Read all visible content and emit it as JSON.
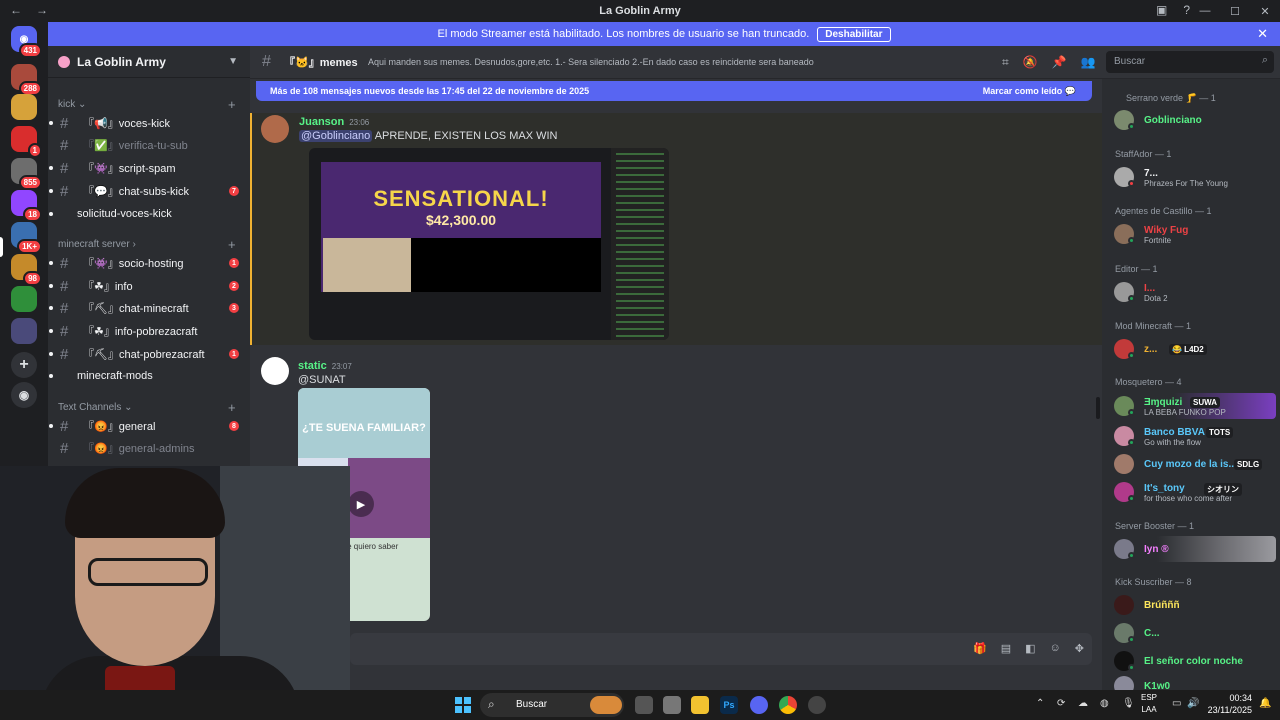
{
  "window": {
    "title": "La Goblin Army",
    "back": "←",
    "forward": "→",
    "minimize": "—",
    "maximize": "☐",
    "close": "✕"
  },
  "banner": {
    "text": "El modo Streamer está habilitado. Los nombres de usuario se han truncado.",
    "button": "Deshabilitar",
    "close": "✕"
  },
  "guilds": [
    {
      "badge": "431",
      "color": "#5865f2",
      "label": "◉"
    },
    {
      "badge": "288",
      "color": "#a94a3c",
      "label": ""
    },
    {
      "badge": "",
      "color": "#d6a23a",
      "label": ""
    },
    {
      "badge": "1",
      "color": "#d92d2d",
      "label": ""
    },
    {
      "badge": "855",
      "color": "#6d6d6d",
      "label": ""
    },
    {
      "badge": "18",
      "color": "#9146ff",
      "label": ""
    },
    {
      "badge": "1K+",
      "color": "#3a6fb0",
      "label": ""
    },
    {
      "badge": "98",
      "color": "#c58a2a",
      "label": ""
    },
    {
      "badge": "",
      "color": "#2f8f3a",
      "label": ""
    },
    {
      "badge": "",
      "color": "#4a4a7a",
      "label": ""
    }
  ],
  "sidebar": {
    "server_name": "La Goblin Army",
    "categories": {
      "kick": "kick",
      "minecraft": "minecraft server",
      "text": "Text Channels",
      "plus": "+"
    },
    "channels": [
      {
        "name": "『📢』voces-kick",
        "muted": false,
        "count": ""
      },
      {
        "name": "『✅』verifica-tu-sub",
        "muted": true,
        "count": ""
      },
      {
        "name": "『👾』script-spam",
        "muted": false,
        "count": ""
      },
      {
        "name": "『💬』chat-subs-kick",
        "muted": false,
        "count": "7"
      },
      {
        "name": "solicitud-voces-kick",
        "muted": false,
        "count": ""
      },
      {
        "name": "『👾』socio-hosting",
        "muted": false,
        "count": "1"
      },
      {
        "name": "『☘』info",
        "muted": false,
        "count": "2"
      },
      {
        "name": "『⛏』chat-minecraft",
        "muted": false,
        "count": "3"
      },
      {
        "name": "『☘』info-pobrezacraft",
        "muted": false,
        "count": ""
      },
      {
        "name": "『⛏』chat-pobrezacraft",
        "muted": false,
        "count": "1"
      },
      {
        "name": "minecraft-mods",
        "muted": false,
        "count": ""
      },
      {
        "name": "『😡』general",
        "muted": false,
        "count": "8"
      },
      {
        "name": "『😡』general-admins",
        "muted": true,
        "count": ""
      }
    ]
  },
  "channel": {
    "name": "『🐱』memes",
    "topic": "Aqui manden sus memes. Desnudos,gore,etc. 1.- Sera silenciado 2.-En dado caso es reincidente sera baneado",
    "search_placeholder": "Buscar"
  },
  "new_messages": {
    "text": "Más de 108 mensajes nuevos desde las 17:45 del 22 de noviembre de 2025",
    "mark": "Marcar como leído"
  },
  "messages": [
    {
      "author": "Juanson",
      "time": "23:06",
      "mention": "@Goblinciano",
      "text": "APRENDE, EXISTEN LOS MAX WIN",
      "image_text": "SENSATIONAL!",
      "image_amount": "$42,300.00"
    },
    {
      "author": "static",
      "time": "23:07",
      "text": "@SUNAT",
      "image_caption": "¿TE SUENA FAMILIAR?",
      "image_sub": "lo que quiero saber"
    }
  ],
  "members": {
    "groups": [
      {
        "label": "Serrano verde 🦵 — 1"
      },
      {
        "label": "StaffAdor — 1"
      },
      {
        "label": "Agentes de Castillo — 1"
      },
      {
        "label": "Editor — 1"
      },
      {
        "label": "Mod Minecraft — 1"
      },
      {
        "label": "Mosquetero — 4"
      },
      {
        "label": "Server Booster — 1"
      },
      {
        "label": "Kick Suscriber — 8"
      }
    ],
    "list": [
      {
        "name": "Goblinciano",
        "status": "",
        "tag": "",
        "color": "#57f287"
      },
      {
        "name": "7...",
        "status": "Phrazes For The Young",
        "tag": "",
        "color": "#f2f3f5"
      },
      {
        "name": "Wiky Fug",
        "status": "Fortnite",
        "tag": "",
        "color": "#ed4245"
      },
      {
        "name": "I...",
        "status": "Dota 2",
        "tag": "",
        "color": "#ed4245"
      },
      {
        "name": "z...",
        "status": "",
        "tag": "😂 L4D2",
        "color": "#f0b232"
      },
      {
        "name": "Ǝɱquizi",
        "status": "LA BEBA FUNKO POP",
        "tag": "SUWA",
        "color": "#57f287"
      },
      {
        "name": "Banco BBVA",
        "status": "Go with the flow",
        "tag": "TOTS",
        "color": "#5ac8fa"
      },
      {
        "name": "Cuy mozo de la is...",
        "status": "",
        "tag": "SDLG",
        "color": "#5ac8fa"
      },
      {
        "name": "It's_tony",
        "status": "for those who come after",
        "tag": "シオリン",
        "color": "#5ac8fa"
      },
      {
        "name": "Iyn ®",
        "status": "",
        "tag": "",
        "color": "#f47fff"
      },
      {
        "name": "Brúñññ",
        "status": "",
        "tag": "",
        "color": "#fee75c"
      },
      {
        "name": "C...",
        "status": "",
        "tag": "",
        "color": "#57f287"
      },
      {
        "name": "El señor color noche",
        "status": "",
        "tag": "",
        "color": "#57f287"
      },
      {
        "name": "K1w0",
        "status": "",
        "tag": "",
        "color": "#57f287"
      }
    ]
  },
  "taskbar": {
    "search": "Buscar",
    "lang1": "ESP",
    "lang2": "LAA",
    "time": "00:34",
    "date": "23/11/2025"
  }
}
